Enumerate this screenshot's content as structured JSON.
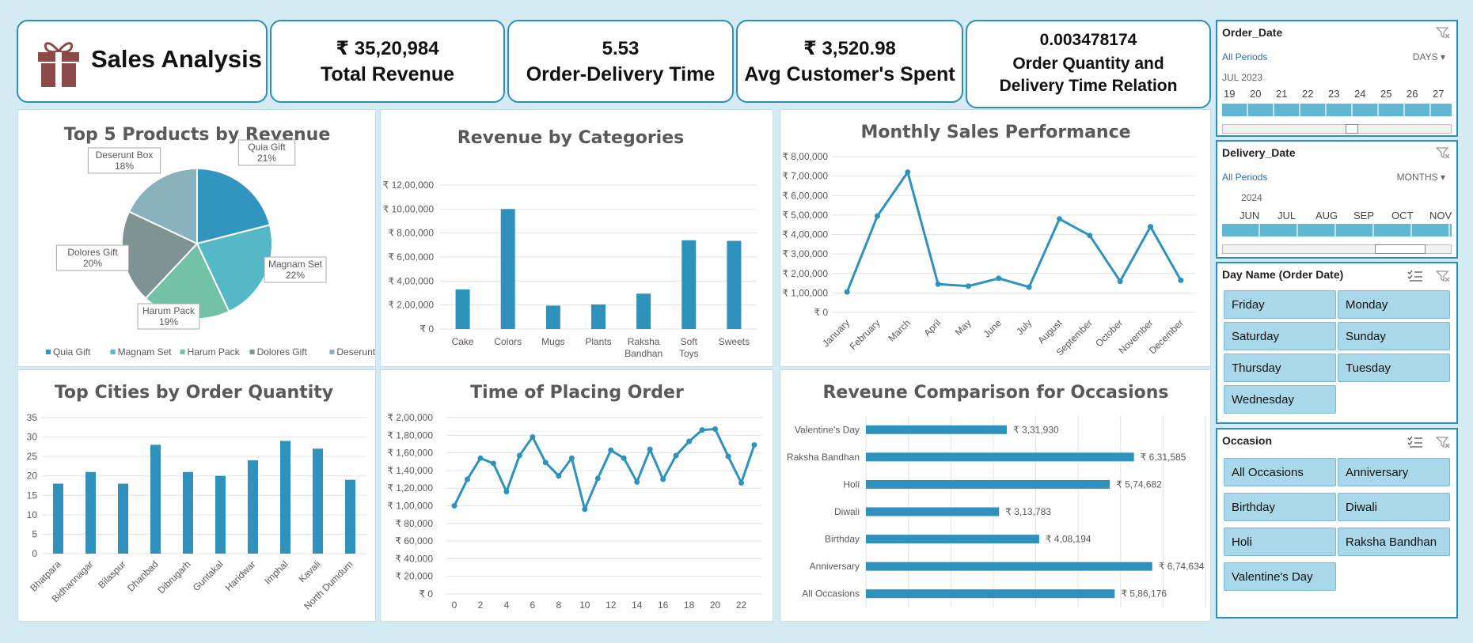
{
  "header": {
    "title": "Sales Analysis",
    "logo_icon": "gift-icon",
    "logo_color": "#8b4a47"
  },
  "kpis": [
    {
      "value": "₹ 35,20,984",
      "label": "Total Revenue"
    },
    {
      "value": "5.53",
      "label": "Order-Delivery Time"
    },
    {
      "value": "₹ 3,520.98",
      "label": "Avg Customer's Spent"
    },
    {
      "value": "0.003478174",
      "label": "Order Quantity and Delivery Time Relation"
    }
  ],
  "colors": {
    "accent": "#2e92bd",
    "border": "#2d8fb8",
    "background": "#d4ebf4",
    "button": "#a8d8ea"
  },
  "chart_data": [
    {
      "id": "pie",
      "type": "pie",
      "title": "Top 5 Products by Revenue",
      "categories": [
        "Quia Gift",
        "Magnam Set",
        "Harum Pack",
        "Dolores Gift",
        "Deserunt Box"
      ],
      "values": [
        21,
        22,
        19,
        20,
        18
      ],
      "data_labels": [
        "21%",
        "22%",
        "19%",
        "20%",
        "18%"
      ],
      "colors": [
        "#3295c0",
        "#55b8c6",
        "#72c2a8",
        "#7f9294",
        "#8ab2bd"
      ],
      "legend": "bottom"
    },
    {
      "id": "categories",
      "type": "bar",
      "title": "Revenue by Categories",
      "categories": [
        "Cake",
        "Colors",
        "Mugs",
        "Plants",
        "Raksha Bandhan",
        "Soft Toys",
        "Sweets"
      ],
      "values": [
        330000,
        1000000,
        195000,
        205000,
        295000,
        740000,
        735000
      ],
      "ylim": [
        0,
        1200000
      ],
      "yticks": [
        "₹ 0",
        "₹ 2,00,000",
        "₹ 4,00,000",
        "₹ 6,00,000",
        "₹ 8,00,000",
        "₹ 10,00,000",
        "₹ 12,00,000"
      ]
    },
    {
      "id": "monthly",
      "type": "line",
      "title": "Monthly Sales Performance",
      "categories": [
        "January",
        "February",
        "March",
        "April",
        "May",
        "June",
        "July",
        "August",
        "September",
        "October",
        "November",
        "December"
      ],
      "values": [
        105000,
        495000,
        720000,
        145000,
        135000,
        175000,
        130000,
        480000,
        395000,
        160000,
        440000,
        165000
      ],
      "ylim": [
        0,
        800000
      ],
      "yticks": [
        "₹ 0",
        "₹ 1,00,000",
        "₹ 2,00,000",
        "₹ 3,00,000",
        "₹ 4,00,000",
        "₹ 5,00,000",
        "₹ 6,00,000",
        "₹ 7,00,000",
        "₹ 8,00,000"
      ]
    },
    {
      "id": "cities",
      "type": "bar",
      "title": "Top Cities by Order Quantity",
      "categories": [
        "Bhatpara",
        "Bidhannagar",
        "Bilaspur",
        "Dhanbad",
        "Dibrugarh",
        "Guntakal",
        "Haridwar",
        "Imphal",
        "Kavali",
        "North Dumdum"
      ],
      "values": [
        18,
        21,
        18,
        28,
        21,
        20,
        24,
        29,
        27,
        19
      ],
      "ylim": [
        0,
        35
      ],
      "yticks": [
        "0",
        "5",
        "10",
        "15",
        "20",
        "25",
        "30",
        "35"
      ]
    },
    {
      "id": "hours",
      "type": "line",
      "title": "Time of Placing Order",
      "x": [
        0,
        1,
        2,
        3,
        4,
        5,
        6,
        7,
        8,
        9,
        10,
        11,
        12,
        13,
        14,
        15,
        16,
        17,
        18,
        19,
        20,
        21,
        22,
        23
      ],
      "values": [
        100000,
        130000,
        154000,
        148000,
        116000,
        157000,
        178000,
        149000,
        134000,
        154000,
        96000,
        131000,
        163000,
        154000,
        127000,
        164000,
        130000,
        157000,
        173000,
        186000,
        187000,
        156000,
        126000,
        169000
      ],
      "ylim": [
        0,
        200000
      ],
      "xticks": [
        "0",
        "2",
        "4",
        "6",
        "8",
        "10",
        "12",
        "14",
        "16",
        "18",
        "20",
        "22"
      ],
      "yticks": [
        "₹ 0",
        "₹ 20,000",
        "₹ 40,000",
        "₹ 60,000",
        "₹ 80,000",
        "₹ 1,00,000",
        "₹ 1,20,000",
        "₹ 1,40,000",
        "₹ 1,60,000",
        "₹ 1,80,000",
        "₹ 2,00,000"
      ]
    },
    {
      "id": "occasions",
      "type": "bar",
      "orientation": "horizontal",
      "title": "Reveune Comparison for Occasions",
      "categories": [
        "Valentine's Day",
        "Raksha Bandhan",
        "Holi",
        "Diwali",
        "Birthday",
        "Anniversary",
        "All Occasions"
      ],
      "values": [
        331930,
        631585,
        574682,
        313783,
        408194,
        674634,
        586176
      ],
      "data_labels": [
        "₹ 3,31,930",
        "₹ 6,31,585",
        "₹ 5,74,682",
        "₹ 3,13,783",
        "₹ 4,08,194",
        "₹ 6,74,634",
        "₹ 5,86,176"
      ],
      "xlim": [
        0,
        800000
      ]
    }
  ],
  "slicers": {
    "order_date": {
      "title": "Order_Date",
      "period": "All Periods",
      "unit": "DAYS",
      "group": "JUL 2023",
      "ticks": [
        "19",
        "20",
        "21",
        "22",
        "23",
        "24",
        "25",
        "26",
        "27"
      ]
    },
    "delivery_date": {
      "title": "Delivery_Date",
      "period": "All Periods",
      "unit": "MONTHS",
      "group": "2024",
      "ticks": [
        "JUN",
        "JUL",
        "AUG",
        "SEP",
        "OCT",
        "NOV"
      ]
    },
    "day_name": {
      "title": "Day Name (Order Date)",
      "items": [
        "Friday",
        "Monday",
        "Saturday",
        "Sunday",
        "Thursday",
        "Tuesday",
        "Wednesday"
      ]
    },
    "occasion": {
      "title": "Occasion",
      "items": [
        "All Occasions",
        "Anniversary",
        "Birthday",
        "Diwali",
        "Holi",
        "Raksha Bandhan",
        "Valentine's Day"
      ]
    }
  }
}
